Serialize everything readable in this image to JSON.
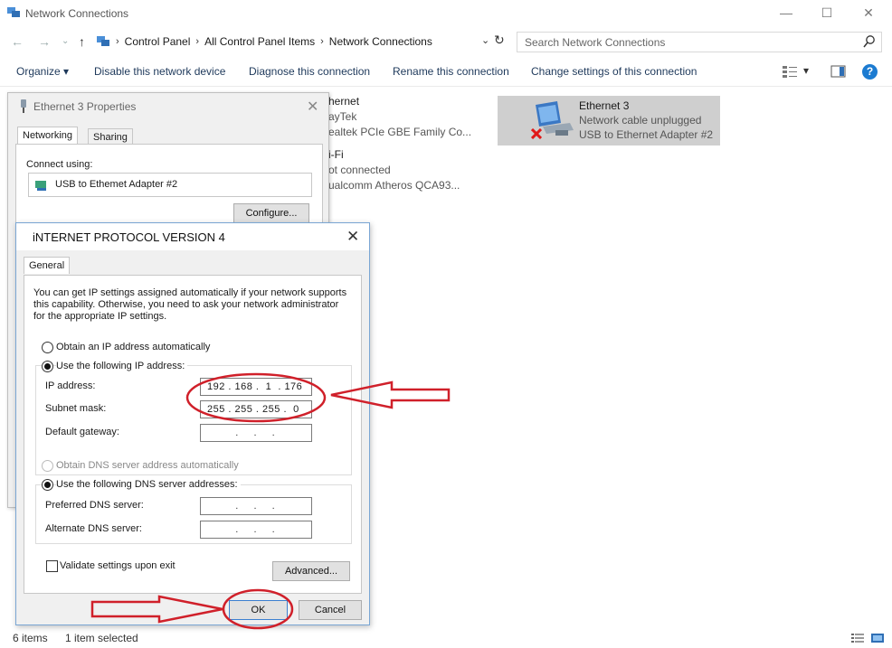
{
  "window": {
    "title": "Network Connections",
    "minimize": "—",
    "maximize": "☐",
    "close": "✕"
  },
  "address": {
    "breadcrumbs": [
      "Control Panel",
      "All Control Panel Items",
      "Network Connections"
    ],
    "search_placeholder": "Search Network Connections"
  },
  "toolbar": {
    "organize": "Organize ▾",
    "disable": "Disable this network device",
    "diagnose": "Diagnose this connection",
    "rename": "Rename this connection",
    "change": "Change settings of this connection",
    "help": "?"
  },
  "connections": [
    {
      "name": "hernet",
      "status": "ayTek",
      "device": "ealtek PCIe GBE Family Co..."
    },
    {
      "name": "i-Fi",
      "status": "ot connected",
      "device": "ualcomm Atheros QCA93..."
    },
    {
      "name": "Ethernet 3",
      "status": "Network cable unplugged",
      "device": "USB to Ethernet Adapter #2"
    }
  ],
  "status_bar": {
    "item_count": "6 items",
    "selected": "1 item selected"
  },
  "properties_dialog": {
    "title": "Ethernet 3 Properties",
    "close": "✕",
    "tabs": [
      "Networking",
      "Sharing"
    ],
    "connect_using_label": "Connect using:",
    "adapter": "USB to Ethemet Adapter #2",
    "configure_button": "Configure..."
  },
  "ipv4_dialog": {
    "title": "iNTERNET PROTOCOL VERSION 4",
    "close": "✕",
    "tab": "General",
    "info": "You can get IP settings assigned automatically if your network supports this capability. Otherwise, you need to ask your network administrator for the appropriate IP settings.",
    "obtain_ip_auto": "Obtain an IP address automatically",
    "use_following_ip": "Use the following IP address:",
    "ip_label": "IP address:",
    "ip_value": "192 . 168 .  1  . 176",
    "subnet_label": "Subnet mask:",
    "subnet_value": "255 . 255 . 255 .  0",
    "gateway_label": "Default gateway:",
    "gateway_value": ".   .   .",
    "obtain_dns_auto": "Obtain DNS server address automatically",
    "use_following_dns": "Use the following DNS server addresses:",
    "preferred_dns_label": "Preferred DNS server:",
    "preferred_dns_value": ".   .   .",
    "alternate_dns_label": "Alternate DNS server:",
    "alternate_dns_value": ".   .   .",
    "validate_label": "Validate settings upon exit",
    "advanced_button": "Advanced...",
    "ok_button": "OK",
    "cancel_button": "Cancel",
    "ip_mode": "manual",
    "dns_mode": "manual",
    "validate_checked": false
  },
  "annotation_color": "#d0202a"
}
